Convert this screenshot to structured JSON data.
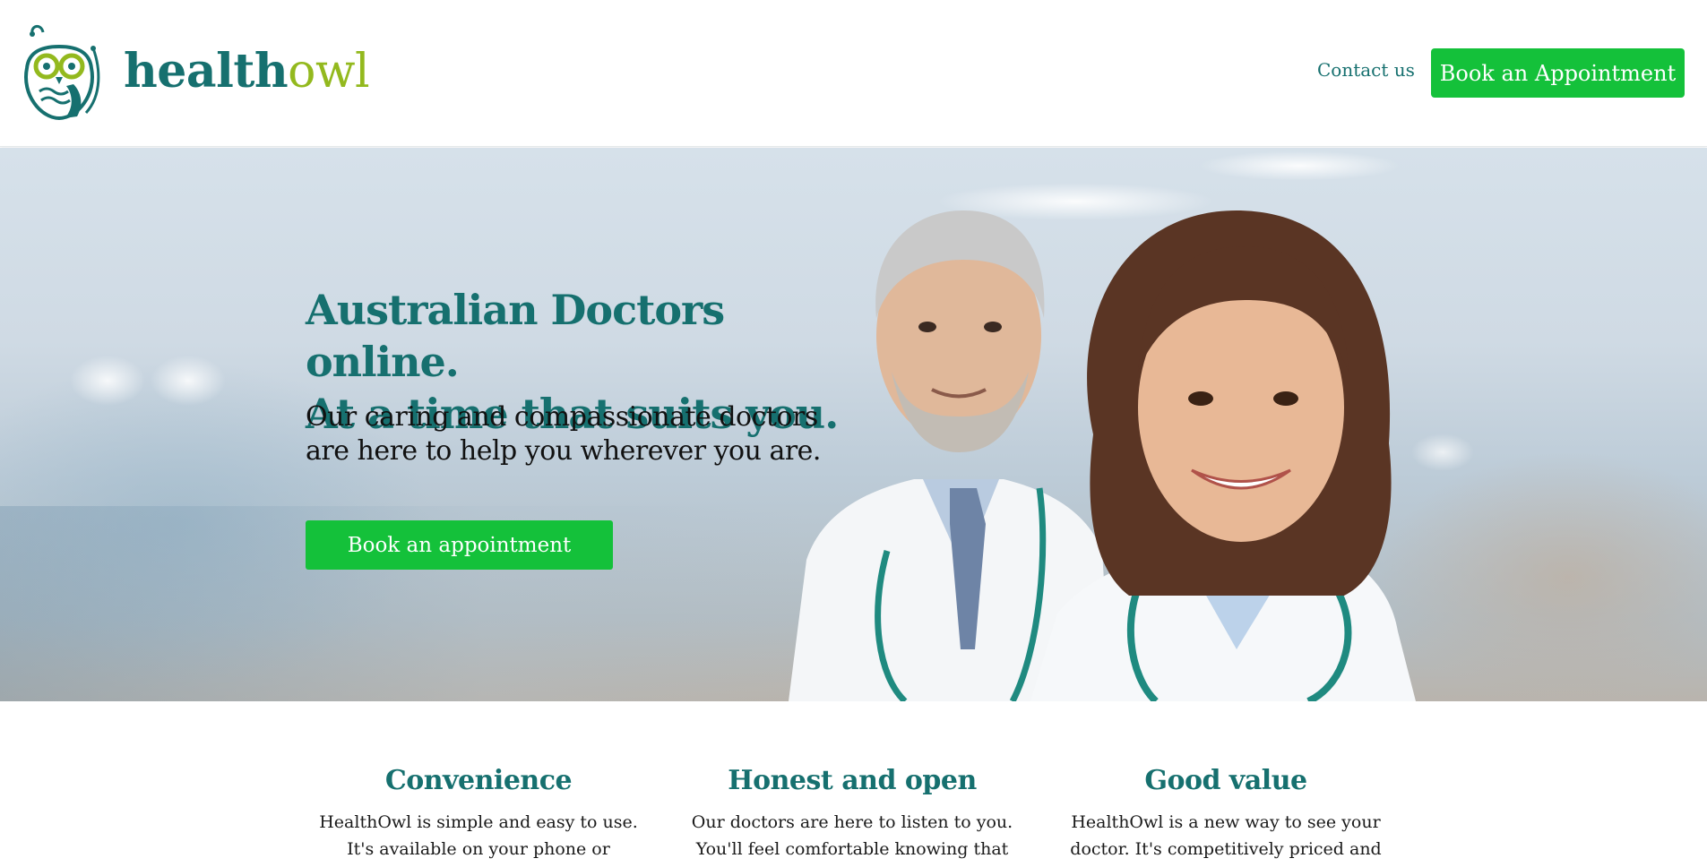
{
  "brand": {
    "name_part1": "health",
    "name_part2": "owl",
    "colors": {
      "teal": "#16706f",
      "lime": "#93b91e",
      "green": "#14c13a"
    }
  },
  "nav": {
    "contact_label": "Contact us",
    "book_label": "Book an Appointment"
  },
  "hero": {
    "title_line1": "Australian Doctors online.",
    "title_line2": "At a time that suits you.",
    "subtitle_line1": "Our caring and compassionate doctors",
    "subtitle_line2": "are here to help you wherever you are.",
    "cta_label": "Book an appointment"
  },
  "features": [
    {
      "title": "Convenience",
      "text_line1": "HealthOwl is simple and easy to use.",
      "text_line2": "It's available on your phone or"
    },
    {
      "title": "Honest and open",
      "text_line1": "Our doctors are here to listen to you.",
      "text_line2": "You'll feel comfortable knowing that"
    },
    {
      "title": "Good value",
      "text_line1": "HealthOwl is a new way to see your",
      "text_line2": "doctor. It's competitively priced and"
    }
  ]
}
